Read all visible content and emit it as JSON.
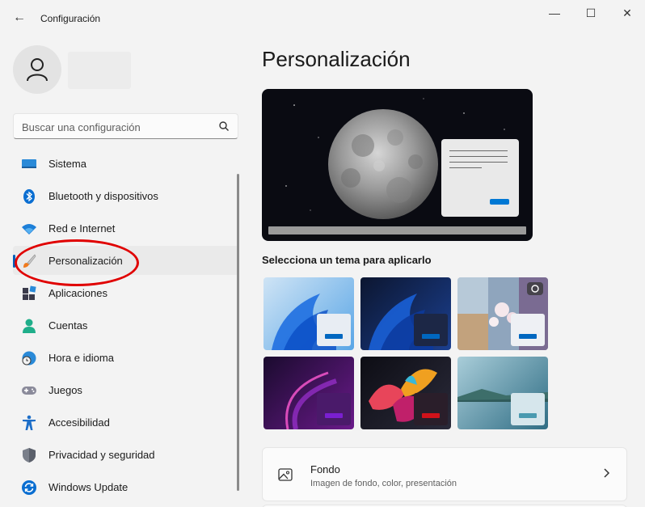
{
  "window": {
    "title": "Configuración",
    "back_glyph": "←",
    "minimize_glyph": "—",
    "maximize_glyph": "☐",
    "close_glyph": "✕"
  },
  "search": {
    "placeholder": "Buscar una configuración",
    "icon": "search-icon"
  },
  "sidebar": {
    "items": [
      {
        "label": "Sistema",
        "icon": "monitor-icon"
      },
      {
        "label": "Bluetooth y dispositivos",
        "icon": "bluetooth-icon"
      },
      {
        "label": "Red e Internet",
        "icon": "wifi-icon"
      },
      {
        "label": "Personalización",
        "icon": "paintbrush-icon",
        "active": true
      },
      {
        "label": "Aplicaciones",
        "icon": "apps-icon"
      },
      {
        "label": "Cuentas",
        "icon": "person-icon"
      },
      {
        "label": "Hora e idioma",
        "icon": "clock-globe-icon"
      },
      {
        "label": "Juegos",
        "icon": "gamepad-icon"
      },
      {
        "label": "Accesibilidad",
        "icon": "accessibility-icon"
      },
      {
        "label": "Privacidad y seguridad",
        "icon": "shield-icon"
      },
      {
        "label": "Windows Update",
        "icon": "update-icon"
      }
    ]
  },
  "main": {
    "title": "Personalización",
    "themes_label": "Selecciona un tema para aplicarlo",
    "themes": [
      {
        "name": "light-bloom",
        "bg": [
          "#cfe4f5",
          "#5aa6e6"
        ],
        "accent": "#0067c0"
      },
      {
        "name": "dark-bloom",
        "bg": [
          "#0c1630",
          "#1b3f8f"
        ],
        "accent": "#0067c0"
      },
      {
        "name": "captured-motion",
        "bg": [
          "#b9c7d6",
          "#7a6b8f"
        ],
        "accent": "#0067c0"
      },
      {
        "name": "glow",
        "bg": [
          "#1a0b2e",
          "#6a1a8a"
        ],
        "accent": "#7a1fd0"
      },
      {
        "name": "flow",
        "bg": [
          "#0d0d14",
          "#2a2a3a"
        ],
        "accent": "#d0121a"
      },
      {
        "name": "sunrise",
        "bg": [
          "#a9cdd9",
          "#2f6d84"
        ],
        "accent": "#4a9ab0"
      }
    ],
    "fondo_card": {
      "title": "Fondo",
      "subtitle": "Imagen de fondo, color, presentación",
      "icon": "picture-icon"
    }
  },
  "colors": {
    "accent": "#005fb8",
    "annotation": "#e00000"
  }
}
